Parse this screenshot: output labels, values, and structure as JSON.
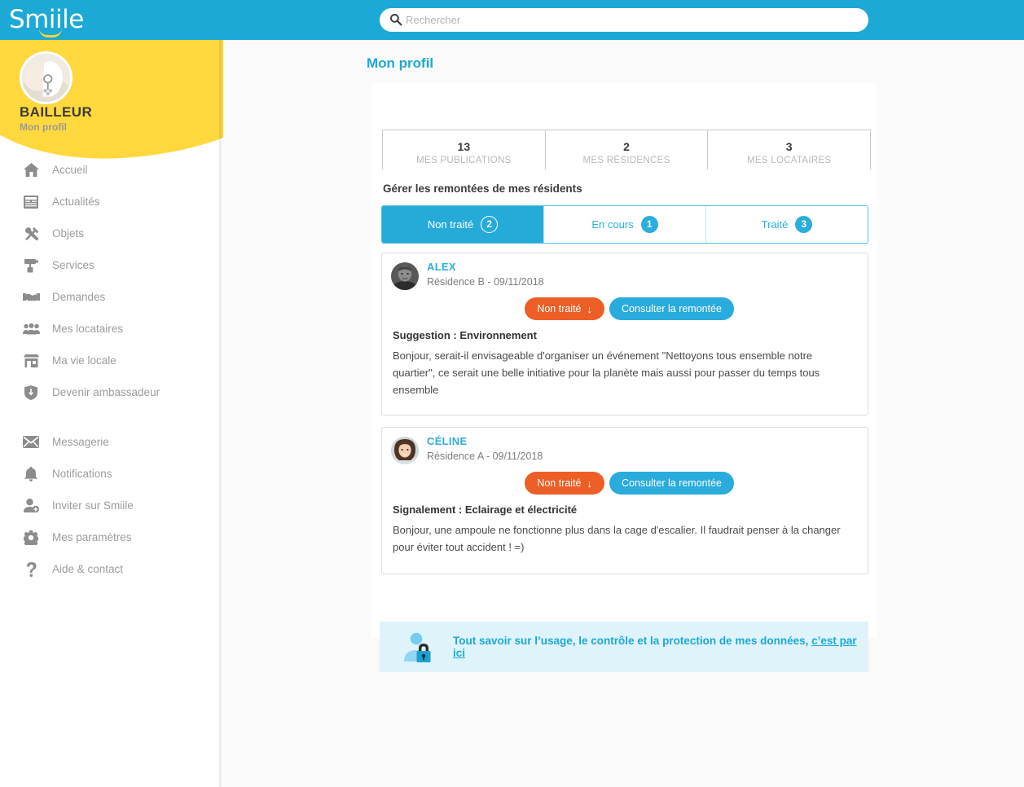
{
  "brand": {
    "name": "Smiile",
    "header_color": "#1ca9d6",
    "accent_yellow": "#ffd83d"
  },
  "search": {
    "placeholder": "Rechercher",
    "value": ""
  },
  "profile": {
    "name": "BAILLEUR",
    "subtitle": "Mon profil"
  },
  "sidebar": {
    "items": [
      {
        "label": "Accueil",
        "icon": "home-icon"
      },
      {
        "label": "Actualités",
        "icon": "newspaper-icon"
      },
      {
        "label": "Objets",
        "icon": "tools-icon"
      },
      {
        "label": "Services",
        "icon": "paint-roller-icon"
      },
      {
        "label": "Demandes",
        "icon": "handshake-icon"
      },
      {
        "label": "Mes locataires",
        "icon": "people-group-icon"
      },
      {
        "label": "Ma vie locale",
        "icon": "shop-icon"
      },
      {
        "label": "Devenir ambassadeur",
        "icon": "shield-icon"
      }
    ],
    "items_secondary": [
      {
        "label": "Messagerie",
        "icon": "envelope-icon"
      },
      {
        "label": "Notifications",
        "icon": "bell-icon"
      },
      {
        "label": "Inviter sur Smiile",
        "icon": "user-add-icon"
      },
      {
        "label": "Mes paramètres",
        "icon": "gear-icon"
      },
      {
        "label": "Aide & contact",
        "icon": "question-mark-icon"
      }
    ]
  },
  "main": {
    "page_title": "Mon profil",
    "stats": [
      {
        "value": "13",
        "label": "MES PUBLICATIONS"
      },
      {
        "value": "2",
        "label": "MES RÉSIDENCES"
      },
      {
        "value": "3",
        "label": "MES LOCATAIRES"
      }
    ],
    "feedback": {
      "title": "Gérer les remontées de mes résidents",
      "tabs": [
        {
          "label": "Non traité",
          "count": "2",
          "active": true
        },
        {
          "label": "En cours",
          "count": "1",
          "active": false
        },
        {
          "label": "Traité",
          "count": "3",
          "active": false
        }
      ],
      "cards": [
        {
          "author": "ALEX",
          "meta": "Résidence B - 09/11/2018",
          "status_label": "Non traité",
          "consult_label": "Consulter la remontée",
          "subject": "Suggestion : Environnement",
          "body": "Bonjour, serait-il envisageable d'organiser un événement \"Nettoyons tous ensemble notre quartier\", ce serait une belle initiative pour la planète mais aussi pour passer du temps tous ensemble"
        },
        {
          "author": "CÉLINE",
          "meta": "Résidence A - 09/11/2018",
          "status_label": "Non traité",
          "consult_label": "Consulter la remontée",
          "subject": "Signalement : Eclairage et électricité",
          "body": "Bonjour, une ampoule ne fonctionne plus dans la cage d'escalier. Il faudrait penser à la changer pour éviter tout accident ! =)"
        }
      ]
    },
    "privacy": {
      "text": "Tout savoir sur l’usage, le contrôle et la protection de mes données,",
      "link": "c’est par ici"
    }
  }
}
